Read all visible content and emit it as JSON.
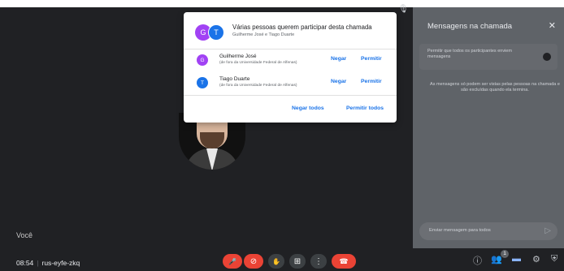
{
  "stage": {
    "self_label": "Você",
    "mic_indicator_icon": "mic-off-icon"
  },
  "bottom_bar": {
    "time": "08:54",
    "separator": "|",
    "meeting_code": "rus-eyfe-zkq",
    "controls": [
      {
        "name": "mic-off-button",
        "icon": "mic-off-icon",
        "glyph": "🎤"
      },
      {
        "name": "camera-off-button",
        "icon": "camera-off-icon",
        "glyph": "⊘"
      },
      {
        "name": "raise-hand-button",
        "icon": "hand-icon",
        "glyph": "✋"
      },
      {
        "name": "present-button",
        "icon": "present-icon",
        "glyph": "⊞"
      },
      {
        "name": "more-options-button",
        "icon": "more-vert-icon",
        "glyph": "⋮"
      },
      {
        "name": "end-call-button",
        "icon": "end-call-icon",
        "glyph": "☎"
      }
    ],
    "right_icons": [
      {
        "name": "info-icon",
        "glyph": "ⓘ"
      },
      {
        "name": "people-icon",
        "glyph": "👥"
      },
      {
        "name": "chat-icon",
        "glyph": "▬"
      },
      {
        "name": "activities-icon",
        "glyph": "⚙"
      },
      {
        "name": "host-controls-icon",
        "glyph": "⛨"
      }
    ],
    "people_badge": "1"
  },
  "chat_panel": {
    "title": "Mensagens na chamada",
    "close_glyph": "✕",
    "allow_text": "Permitir que todos os participantes enviem mensagens",
    "info_text": "As mensagens só podem ser vistas pelas pessoas na chamada e são excluídas quando ela termina.",
    "input_placeholder": "Enviar mensagem para todos",
    "send_glyph": "▷"
  },
  "join_dialog": {
    "group_avatars": [
      "G",
      "T"
    ],
    "title": "Várias pessoas querem participar desta chamada",
    "subtitle": "Guilherme José e Tiago Duarte",
    "requests": [
      {
        "initial": "G",
        "name": "Guilherme José",
        "org": "(de fora da Universidade Federal de Alfenas)",
        "deny": "Negar",
        "allow": "Permitir"
      },
      {
        "initial": "T",
        "name": "Tiago Duarte",
        "org": "(de fora da Universidade Federal de Alfenas)",
        "deny": "Negar",
        "allow": "Permitir"
      }
    ],
    "deny_all": "Negar todos",
    "allow_all": "Permitir todos"
  },
  "colors": {
    "background": "#202124",
    "panel": "#5f6368",
    "accent_blue": "#1a73e8",
    "end_call_red": "#ea4335",
    "avatar_g": "#a142f4",
    "avatar_t": "#1a73e8"
  }
}
